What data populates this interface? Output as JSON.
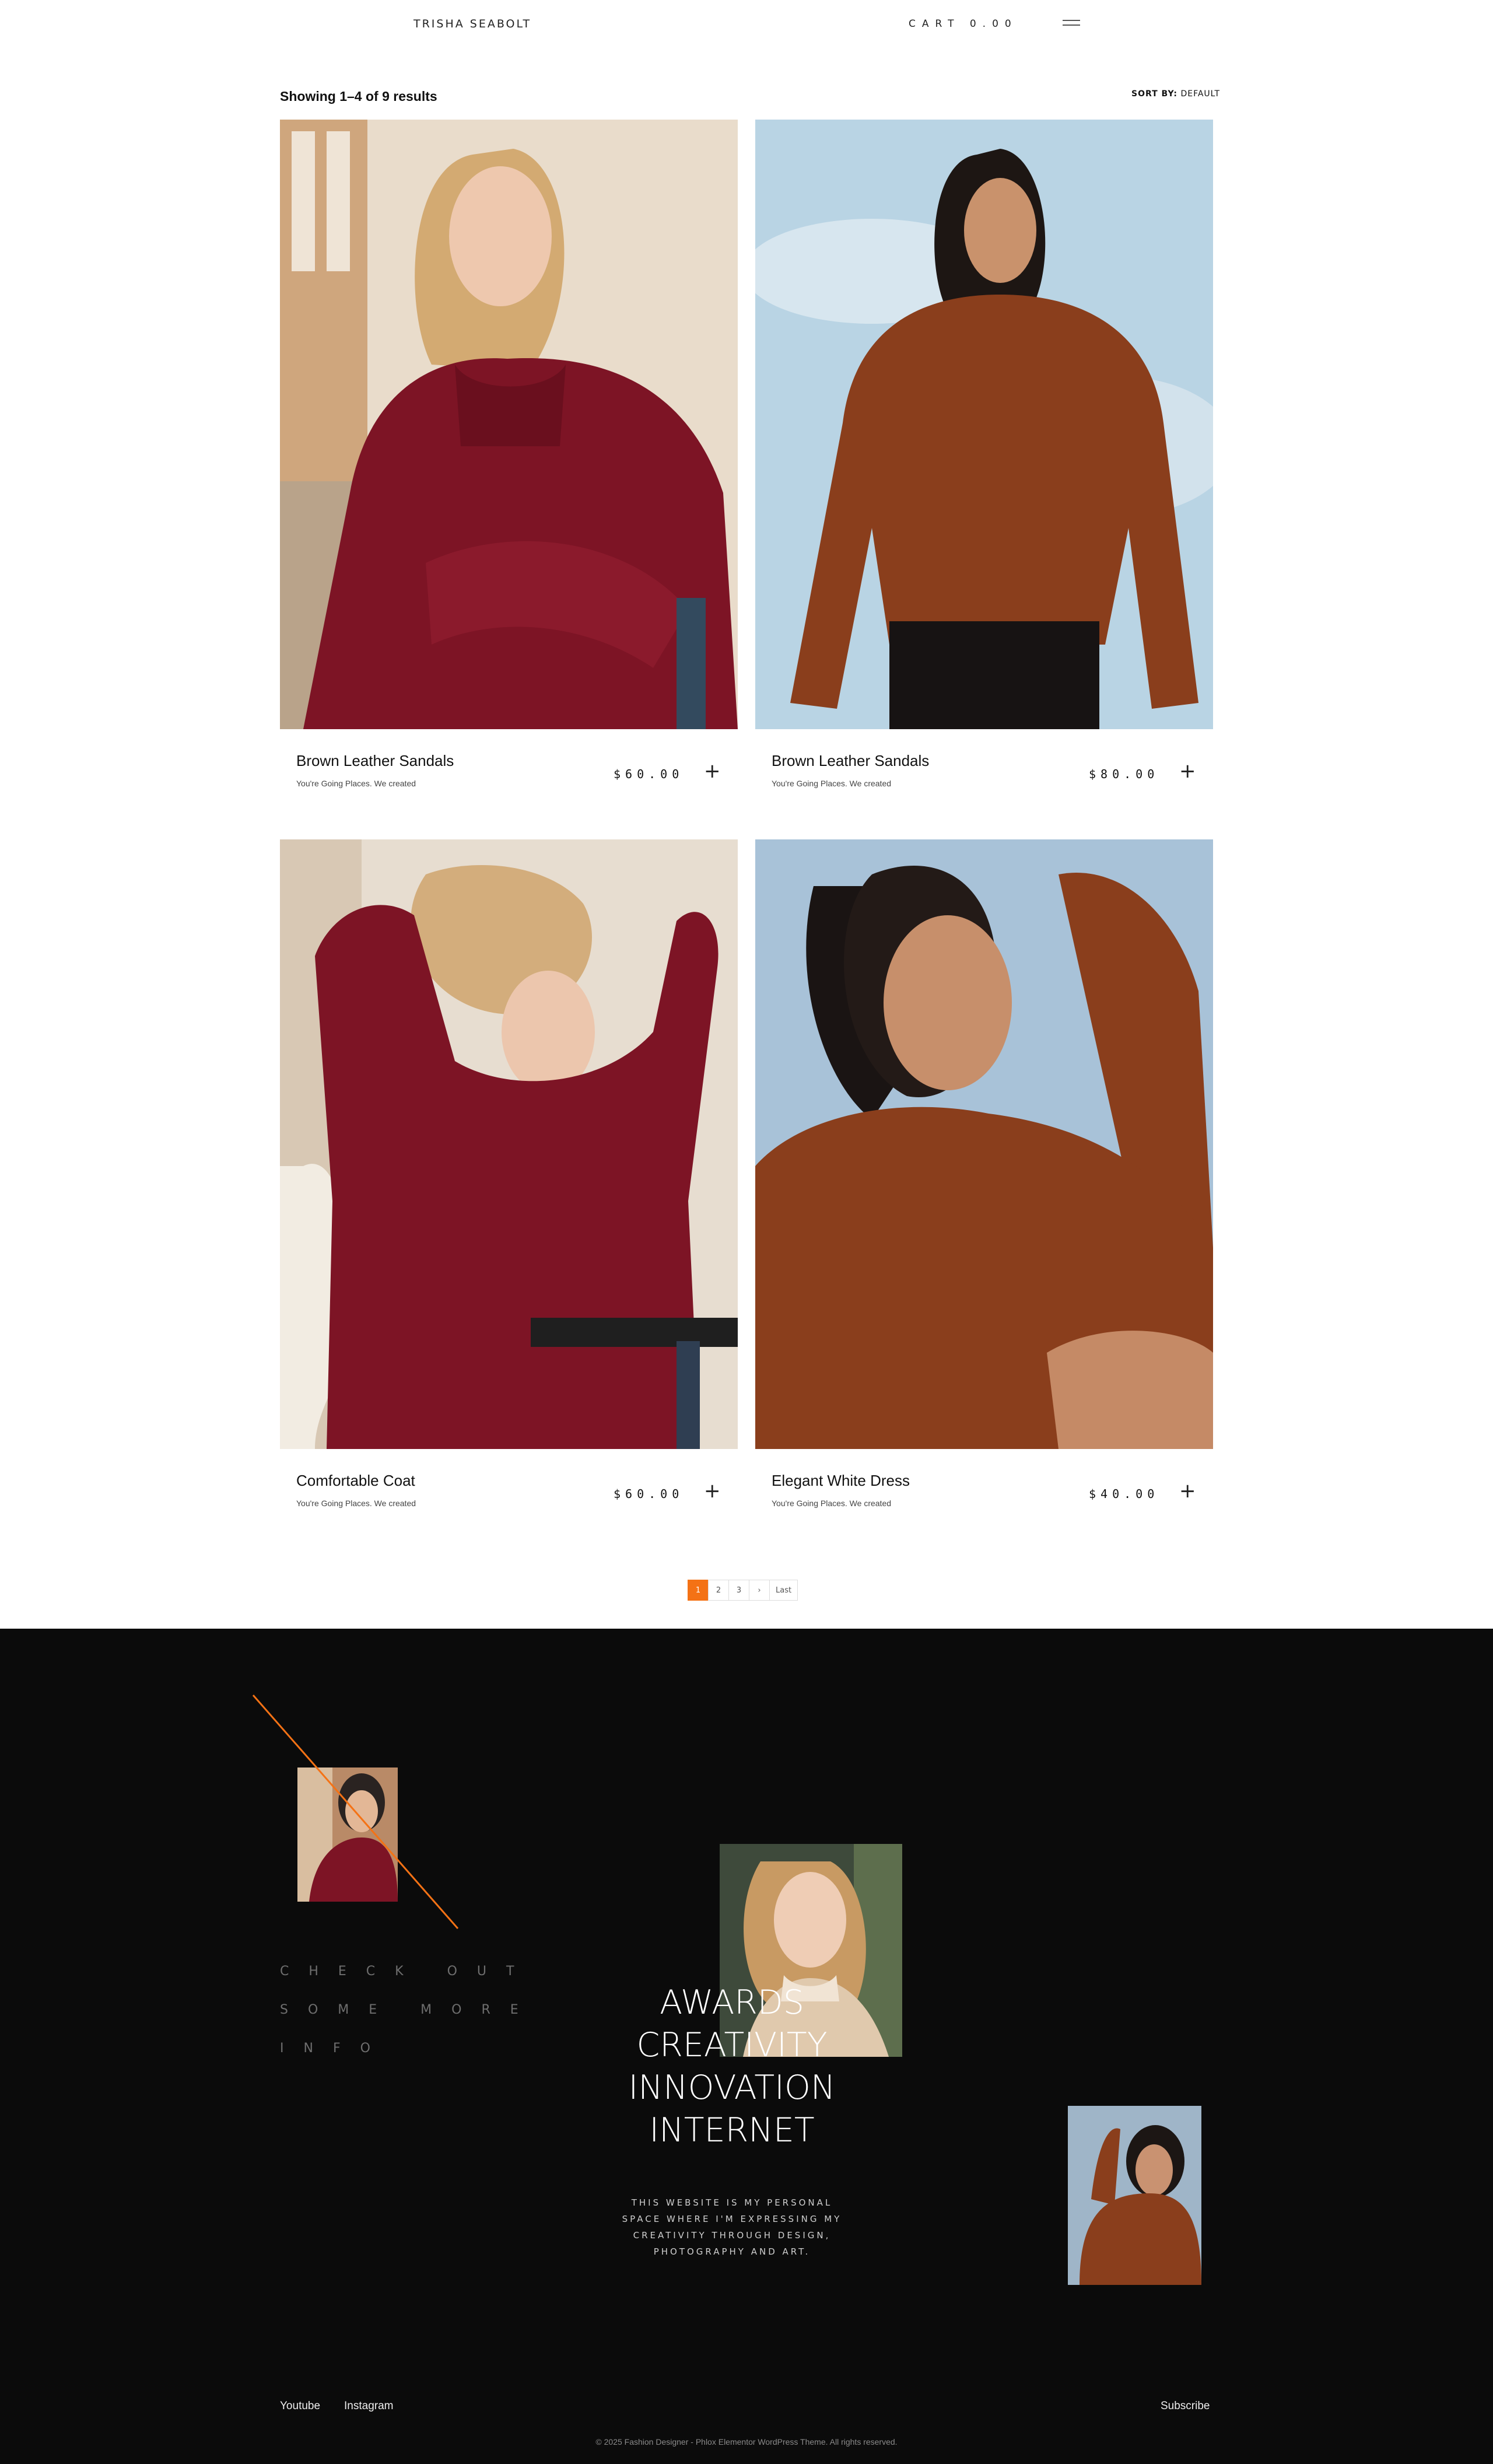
{
  "header": {
    "brand": "TRISHA SEABOLT",
    "cart_label": "CART 0.00"
  },
  "toolbar": {
    "results_text": "Showing 1–4 of 9 results",
    "sort_label": "SORT BY:",
    "sort_value": "DEFAULT"
  },
  "products": [
    {
      "name": "Brown Leather Sandals",
      "subtitle": "You're Going Places. We created",
      "price": "$60.00"
    },
    {
      "name": "Brown Leather Sandals",
      "subtitle": "You're Going Places. We created",
      "price": "$80.00"
    },
    {
      "name": "Comfortable Coat",
      "subtitle": "You're Going Places. We created",
      "price": "$60.00"
    },
    {
      "name": "Elegant White Dress",
      "subtitle": "You're Going Places. We created",
      "price": "$40.00"
    }
  ],
  "pagination": {
    "pages": [
      "1",
      "2",
      "3"
    ],
    "next": "›",
    "last": "Last",
    "current": "1"
  },
  "footer": {
    "check_lines": [
      "CHECK OUT",
      "SOME MORE",
      "INFO"
    ],
    "headline_lines": [
      "AWARDS",
      "CREATIVITY",
      "INNOVATION",
      "INTERNET"
    ],
    "blurb": "THIS WEBSITE IS MY PERSONAL SPACE WHERE I'M EXPRESSING MY CREATIVITY THROUGH DESIGN, PHOTOGRAPHY AND ART.",
    "links": {
      "youtube": "Youtube",
      "instagram": "Instagram",
      "subscribe": "Subscribe"
    },
    "copyright": "© 2025 Fashion Designer - Phlox Elementor WordPress Theme. All rights reserved."
  },
  "colors": {
    "accent": "#f47215",
    "footer_bg": "#0b0b0b",
    "burgundy": "#7d1425",
    "rust": "#8a3e1c"
  },
  "icons": {
    "menu": "hamburger-icon",
    "add": "plus-icon"
  }
}
